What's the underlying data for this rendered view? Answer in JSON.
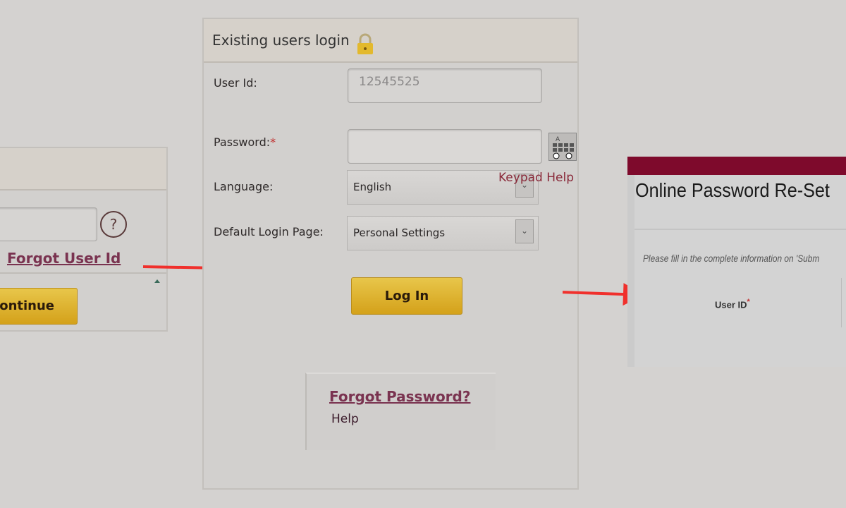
{
  "left_panel": {
    "forgot_user_id": "Forgot User Id",
    "help_icon": "?",
    "continue_label": "Continue",
    "continue_visible": "ontinue"
  },
  "login": {
    "title": "Existing users login",
    "lock_icon": "lock-icon",
    "user_id_label": "User Id:",
    "user_id_value": "12545525",
    "password_label": "Password:",
    "required_mark": "*",
    "password_value": "",
    "keypad_icon": "virtual-keypad-icon",
    "keypad_help": "Keypad Help",
    "language_label": "Language:",
    "language_value": "English",
    "default_page_label": "Default Login Page:",
    "default_page_value": "Personal Settings",
    "login_button": "Log In",
    "forgot_password": "Forgot Password?",
    "help": "Help"
  },
  "reset": {
    "title": "Online Password Re-Set",
    "instructions": "Please fill in the complete information on 'Subm",
    "user_id_label": "User ID",
    "required_mark": "*",
    "accent": "#7e0a2c"
  },
  "colors": {
    "arrow": "#f0302c",
    "button": "#dcae28",
    "link": "#7a3350"
  }
}
